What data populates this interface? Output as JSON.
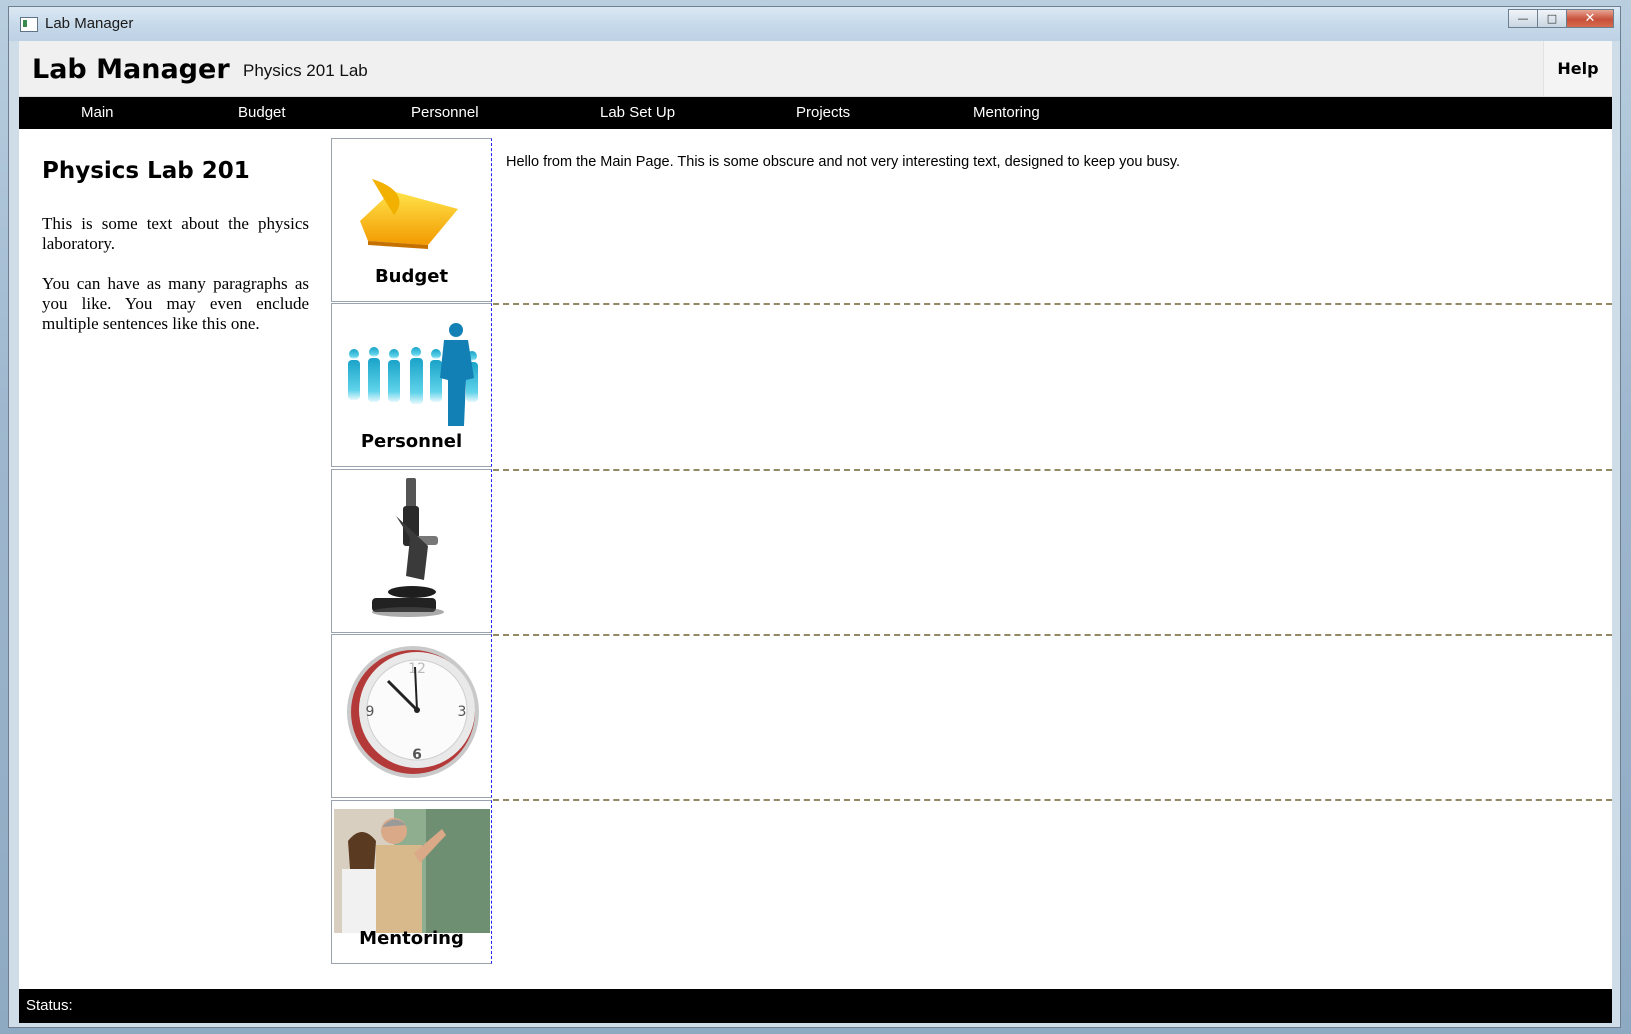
{
  "window": {
    "title": "Lab Manager"
  },
  "header": {
    "app_title": "Lab Manager",
    "subtitle": "Physics 201 Lab",
    "help_label": "Help"
  },
  "nav": {
    "items": [
      "Main",
      "Budget",
      "Personnel",
      "Lab Set Up",
      "Projects",
      "Mentoring"
    ]
  },
  "sidebar": {
    "title": "Physics Lab 201",
    "paragraphs": [
      "This is some text about the physics laboratory.",
      "You can have as many paragraphs as you like. You may even enclude multiple sentences like this one."
    ]
  },
  "tiles": [
    {
      "label": "Budget",
      "icon": "sticky-note-icon"
    },
    {
      "label": "Personnel",
      "icon": "people-silhouettes-icon"
    },
    {
      "label": "",
      "icon": "microscope-icon"
    },
    {
      "label": "",
      "icon": "clock-icon"
    },
    {
      "label": "Mentoring",
      "icon": "teacher-student-photo"
    }
  ],
  "main": {
    "text": "Hello from the Main Page. This is some obscure and not very interesting text, designed to keep you busy."
  },
  "status": {
    "label": "Status:"
  },
  "colors": {
    "nav_bg": "#000000",
    "status_bg": "#000000",
    "header_bg": "#f0f0f0",
    "grid_line": "#3333dd"
  }
}
